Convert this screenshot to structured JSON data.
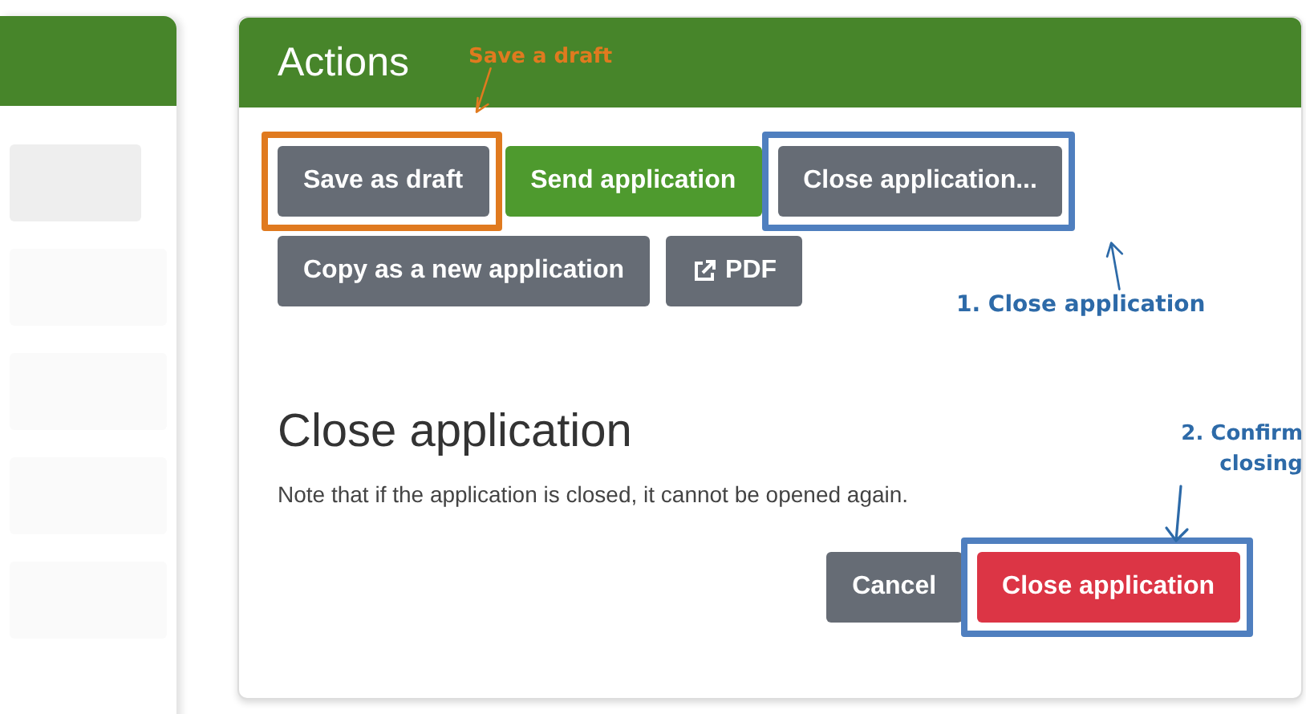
{
  "left_panel": {
    "fields": [
      {
        "kind": "filled"
      },
      {
        "kind": "plain"
      },
      {
        "kind": "plain"
      },
      {
        "kind": "plain"
      },
      {
        "kind": "plain"
      }
    ]
  },
  "actions": {
    "title": "Actions",
    "buttons": [
      [
        {
          "label": "Save as draft",
          "kind": "secondary",
          "color": "#e07a1f"
        },
        {
          "label": "Send application",
          "kind": "success"
        },
        {
          "label": "Close application...",
          "kind": "secondary",
          "color": "#4f7fbf"
        }
      ],
      [
        {
          "label": "Copy as a new application",
          "kind": "secondary"
        },
        {
          "label": "PDF",
          "kind": "export"
        }
      ]
    ],
    "dialog": {
      "title": "Close application",
      "text": "Note that if the application is closed, it cannot be opened again.",
      "buttons": [
        {
          "label": "Cancel",
          "kind": "secondary"
        },
        {
          "label": "Close application",
          "kind": "danger",
          "color": "#4f7fbf"
        }
      ]
    }
  },
  "annotations": [
    {
      "text": "Save a draft",
      "color": "#e07a1f"
    },
    {
      "text": "1. Close application",
      "color": "#2d6aa8"
    },
    {
      "text": "2. Confirm closing",
      "color": "#2d6aa8"
    }
  ]
}
